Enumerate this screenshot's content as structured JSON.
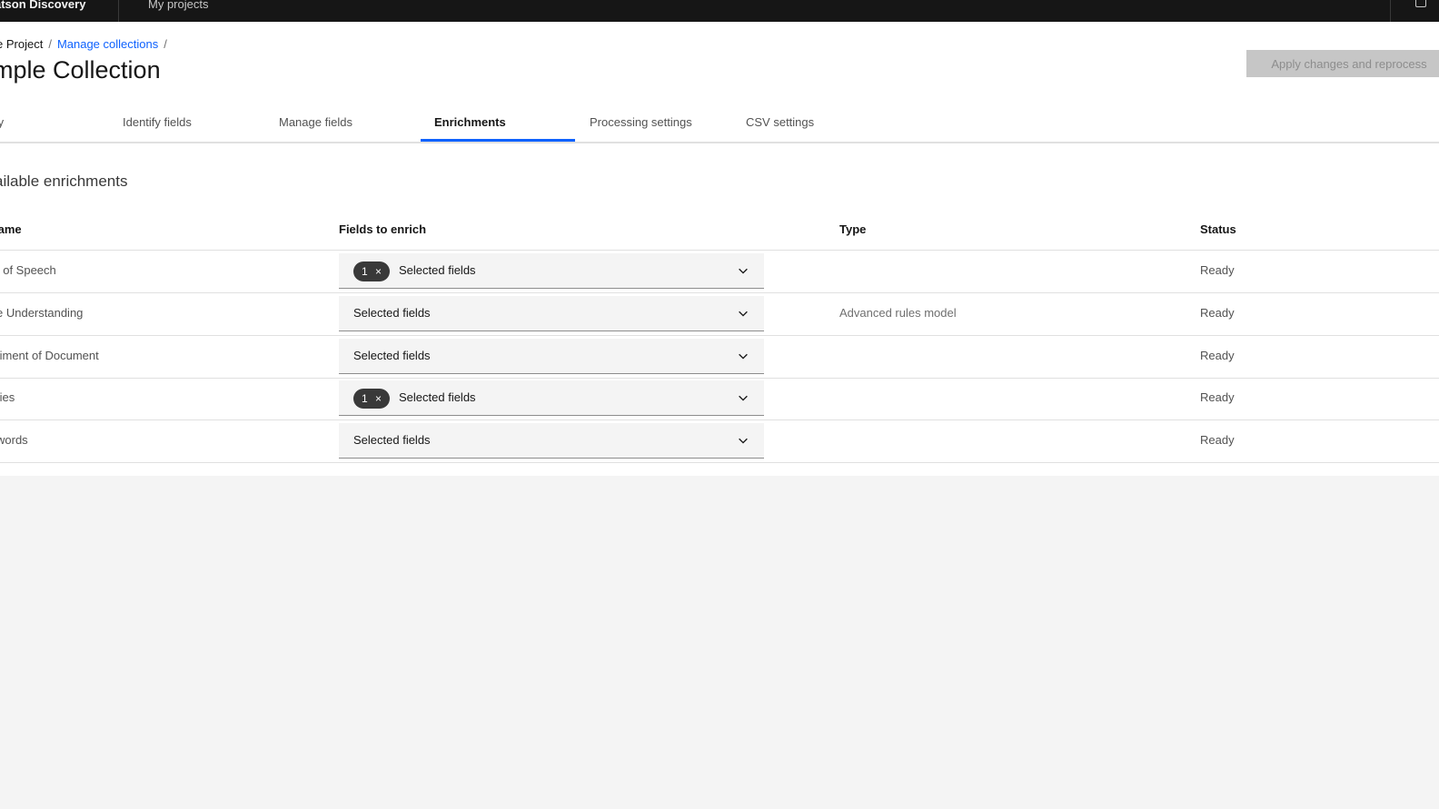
{
  "topbar": {
    "product": "atson Discovery",
    "nav_link": "My projects"
  },
  "breadcrumb": {
    "project": "e Project",
    "separator": "/",
    "manage": "Manage collections",
    "trailing_separator": "/"
  },
  "page_title": "mple Collection",
  "apply_button": "Apply changes and reprocess",
  "tabs": [
    {
      "label": "ty",
      "active": false
    },
    {
      "label": "Identify fields",
      "active": false
    },
    {
      "label": "Manage fields",
      "active": false
    },
    {
      "label": "Enrichments",
      "active": true
    },
    {
      "label": "Processing settings",
      "active": false
    },
    {
      "label": "CSV settings",
      "active": false
    }
  ],
  "section_title": "ailable enrichments",
  "table": {
    "columns": [
      "lame",
      "Fields to enrich",
      "Type",
      "Status"
    ],
    "rows": [
      {
        "name": "t of Speech",
        "tag_count": "1",
        "tag_remove": "×",
        "field_label": "Selected fields",
        "type": "",
        "status": "Ready"
      },
      {
        "name": "e Understanding",
        "field_label": "Selected fields",
        "type": "Advanced rules model",
        "status": "Ready"
      },
      {
        "name": "timent of Document",
        "field_label": "Selected fields",
        "type": "",
        "status": "Ready"
      },
      {
        "name": "ties",
        "tag_count": "1",
        "tag_remove": "×",
        "field_label": "Selected fields",
        "type": "",
        "status": "Ready"
      },
      {
        "name": "words",
        "field_label": "Selected fields",
        "type": "",
        "status": "Ready"
      }
    ]
  },
  "icons": {
    "dropdown": "chevron-down-icon",
    "tag_remove": "close-icon",
    "user": "user-icon"
  },
  "colors": {
    "topbar": "#161616",
    "link": "#0f62fe",
    "active_tab_underline": "#0f62fe",
    "tag_background": "#393939",
    "disabled_button": "#c6c6c6",
    "page_background": "#f4f4f4"
  }
}
